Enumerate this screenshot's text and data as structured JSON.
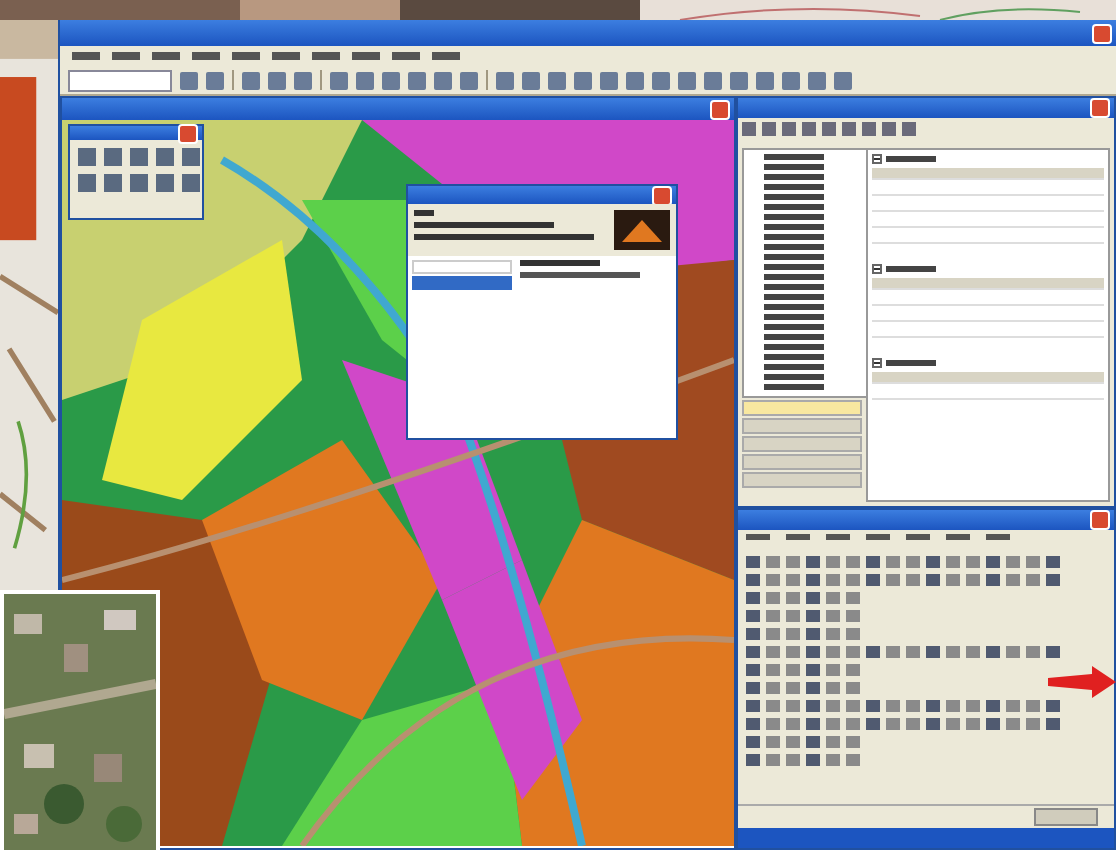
{
  "app_window": {
    "menu": [
      {
        "kind": "menu"
      },
      {
        "kind": "menu"
      },
      {
        "kind": "menu"
      },
      {
        "kind": "menu"
      },
      {
        "kind": "menu"
      },
      {
        "kind": "menu"
      },
      {
        "kind": "menu"
      },
      {
        "kind": "menu"
      },
      {
        "kind": "menu"
      },
      {
        "kind": "menu"
      }
    ],
    "toolbar": [
      {
        "kind": "field"
      },
      {
        "kind": "tool"
      },
      {
        "kind": "tool"
      },
      {
        "kind": "separator"
      },
      {
        "kind": "tool"
      },
      {
        "kind": "tool"
      },
      {
        "kind": "tool"
      },
      {
        "kind": "separator"
      },
      {
        "kind": "tool"
      },
      {
        "kind": "tool"
      },
      {
        "kind": "tool"
      },
      {
        "kind": "tool"
      },
      {
        "kind": "tool"
      },
      {
        "kind": "tool"
      },
      {
        "kind": "separator"
      },
      {
        "kind": "tool"
      },
      {
        "kind": "tool"
      },
      {
        "kind": "tool"
      },
      {
        "kind": "tool"
      },
      {
        "kind": "tool"
      },
      {
        "kind": "tool"
      },
      {
        "kind": "tool"
      },
      {
        "kind": "tool"
      },
      {
        "kind": "tool"
      },
      {
        "kind": "tool"
      },
      {
        "kind": "tool"
      },
      {
        "kind": "tool"
      },
      {
        "kind": "tool"
      },
      {
        "kind": "tool"
      }
    ]
  },
  "map_window": {
    "kind": "map"
  },
  "tool_palette": {
    "tools": [
      {
        "kind": "tool"
      },
      {
        "kind": "tool"
      },
      {
        "kind": "tool"
      },
      {
        "kind": "tool"
      },
      {
        "kind": "tool"
      },
      {
        "kind": "tool"
      },
      {
        "kind": "tool"
      },
      {
        "kind": "tool"
      },
      {
        "kind": "tool"
      },
      {
        "kind": "tool"
      }
    ]
  },
  "dialog": {
    "rows": [
      {
        "selected": false
      },
      {
        "selected": true
      }
    ]
  },
  "layer_panel": {
    "tree_rows": [
      {
        "selected": false
      },
      {
        "selected": false
      },
      {
        "selected": false
      },
      {
        "selected": false
      },
      {
        "selected": false
      },
      {
        "selected": false
      },
      {
        "selected": false
      },
      {
        "selected": false
      },
      {
        "selected": false
      },
      {
        "selected": false
      },
      {
        "selected": false
      },
      {
        "selected": false
      },
      {
        "selected": false
      },
      {
        "selected": false
      },
      {
        "selected": false
      },
      {
        "selected": false
      },
      {
        "selected": false
      },
      {
        "selected": false
      },
      {
        "selected": false
      },
      {
        "selected": false
      },
      {
        "selected": false
      },
      {
        "selected": false
      },
      {
        "selected": false
      },
      {
        "selected": false
      }
    ],
    "sections": [
      {
        "expanded": true,
        "rows": [
          {
            "kind": "header"
          },
          {
            "kind": "row"
          },
          {
            "kind": "row"
          },
          {
            "kind": "row"
          },
          {
            "kind": "row"
          }
        ]
      },
      {
        "expanded": true,
        "rows": [
          {
            "kind": "header"
          },
          {
            "kind": "row"
          },
          {
            "kind": "row"
          },
          {
            "kind": "row"
          }
        ]
      },
      {
        "expanded": true,
        "rows": [
          {
            "kind": "header"
          },
          {
            "kind": "row"
          }
        ]
      }
    ],
    "side_tabs": [
      {
        "selected": true
      },
      {
        "selected": false
      },
      {
        "selected": false
      },
      {
        "selected": false
      },
      {
        "selected": false
      }
    ]
  },
  "symbol_panel": {
    "rows": [
      {
        "kind": "icons"
      },
      {
        "kind": "icons"
      },
      {
        "kind": "short"
      },
      {
        "kind": "short"
      },
      {
        "kind": "short"
      },
      {
        "kind": "icons"
      },
      {
        "kind": "short"
      },
      {
        "kind": "short"
      },
      {
        "kind": "icons"
      },
      {
        "kind": "icons"
      },
      {
        "kind": "short"
      },
      {
        "kind": "short"
      }
    ]
  }
}
